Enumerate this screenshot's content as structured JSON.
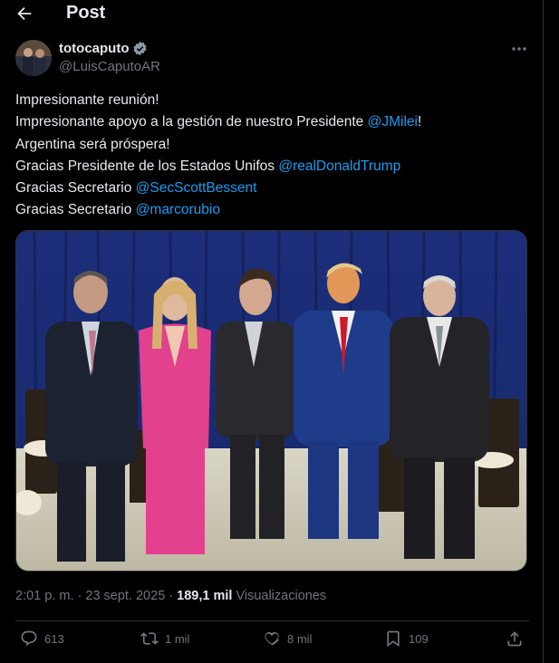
{
  "header": {
    "title": "Post"
  },
  "author": {
    "display_name": "totocaputo",
    "handle": "@LuisCaputoAR"
  },
  "tweet": {
    "lines": [
      [
        {
          "t": "Impresionante reunión!"
        }
      ],
      [
        {
          "t": "Impresionante apoyo a la gestión de nuestro Presidente "
        },
        {
          "t": "@JMilei",
          "m": true
        },
        {
          "t": "!"
        }
      ],
      [
        {
          "t": "Argentina será próspera!"
        }
      ],
      [
        {
          "t": "Gracias Presidente de los Estados Unifos "
        },
        {
          "t": "@realDonaldTrump",
          "m": true
        }
      ],
      [
        {
          "t": "Gracias Secretario "
        },
        {
          "t": "@SecScottBessent",
          "m": true
        }
      ],
      [
        {
          "t": "Gracias Secretario "
        },
        {
          "t": "@marcorubio",
          "m": true
        }
      ]
    ]
  },
  "meta": {
    "time": "2:01 p. m.",
    "dot": " · ",
    "date": "23 sept. 2025",
    "dot2": " · ",
    "views": "189,1 mil",
    "views_label": " Visualizaciones"
  },
  "actions": {
    "replies": "613",
    "reposts": "1 mil",
    "likes": "8 mil",
    "bookmarks": "109"
  },
  "icons": {
    "back": "arrow-left-icon",
    "verified": "verified-badge-icon",
    "more": "more-dots-icon",
    "reply": "reply-icon",
    "repost": "repost-icon",
    "like": "heart-icon",
    "bookmark": "bookmark-icon",
    "share": "share-icon"
  },
  "colors": {
    "accent": "#1d9bf0",
    "muted": "#71767b",
    "text": "#e7e9ea",
    "border": "#2f3336"
  }
}
